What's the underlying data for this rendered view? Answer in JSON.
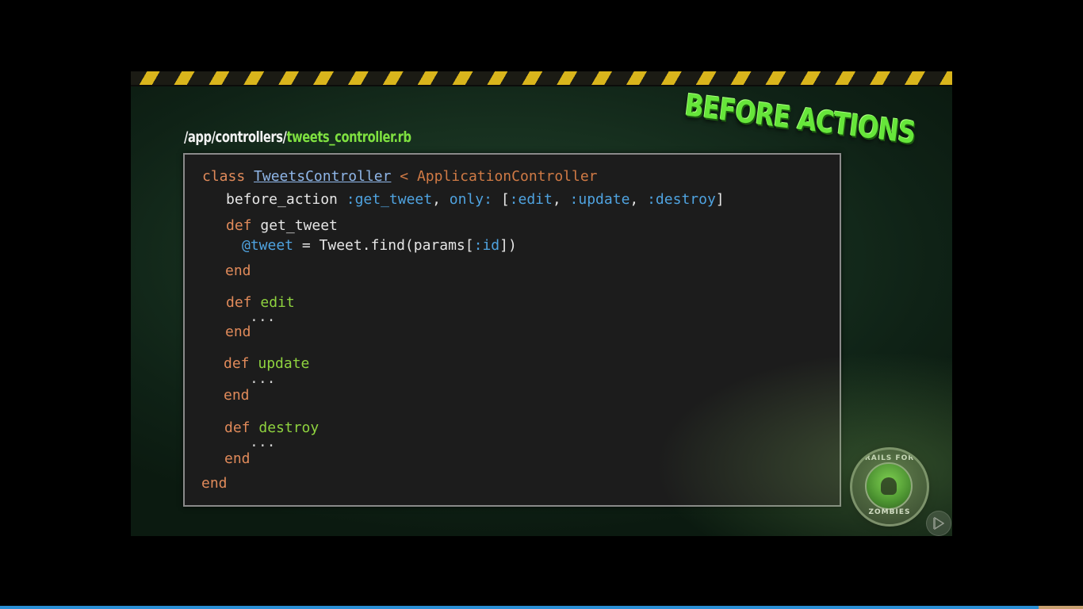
{
  "slide": {
    "title": "BEFORE ACTIONS",
    "path_prefix": "/app/controllers/",
    "path_file": "tweets_controller.rb",
    "badge_top_text": "RAILS FOR",
    "badge_bottom_text": "ZOMBIES"
  },
  "code": {
    "l1": {
      "kw": "class",
      "cls": "TweetsController",
      "op": " < ",
      "sup": "ApplicationController"
    },
    "l2": {
      "fn": "before_action",
      "sym1": ":get_tweet",
      "comma1": ", ",
      "opt": "only:",
      "open": " [",
      "sym2": ":edit",
      "c2": ", ",
      "sym3": ":update",
      "c3": ", ",
      "sym4": ":destroy",
      "close": "]"
    },
    "l3": {
      "kw": "def",
      "name": "get_tweet"
    },
    "l4": {
      "ivar": "@tweet",
      "eq": " = Tweet.find(params[",
      "sym": ":id",
      "tail": "])"
    },
    "l5": {
      "kw": "end"
    },
    "l6": {
      "kw": "def",
      "name": "edit"
    },
    "l7": {
      "dots": "..."
    },
    "l8": {
      "kw": "end"
    },
    "l9": {
      "kw": "def",
      "name": "update"
    },
    "l10": {
      "dots": "..."
    },
    "l11": {
      "kw": "end"
    },
    "l12": {
      "kw": "def",
      "name": "destroy"
    },
    "l13": {
      "dots": "..."
    },
    "l14": {
      "kw": "end"
    },
    "l15": {
      "kw": "end"
    }
  },
  "colors": {
    "keyword": "#e08a5a",
    "method_name": "#8fd33f",
    "symbol": "#4fa3e0",
    "title_green": "#66e63a",
    "progress_bar": "#2a8fd6"
  },
  "icons": {
    "badge": "rails-for-zombies-logo-icon",
    "play": "play-icon"
  }
}
